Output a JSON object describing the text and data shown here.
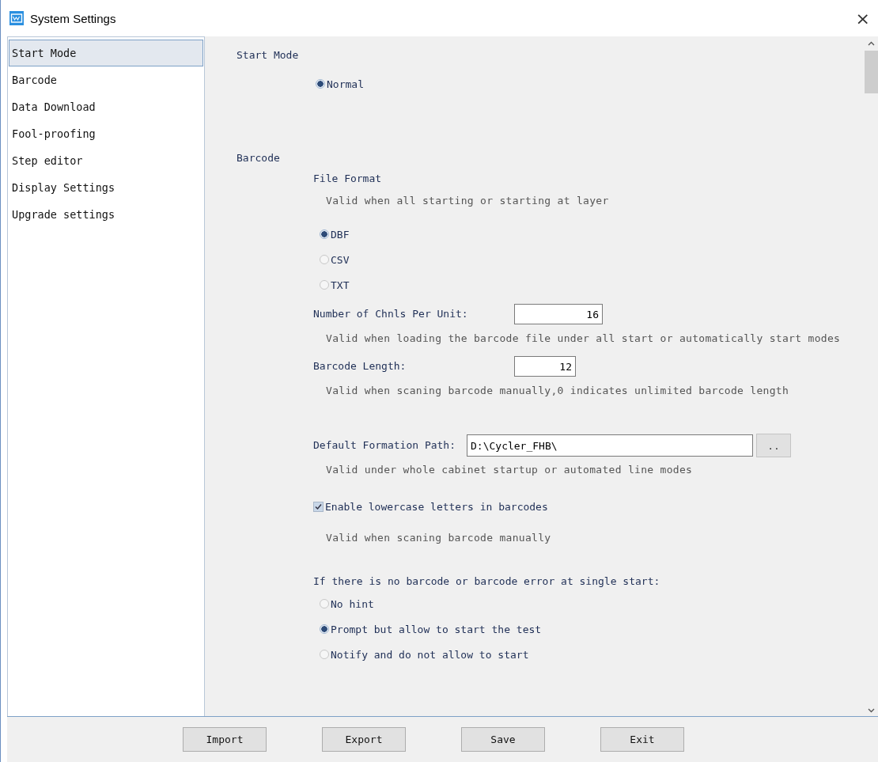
{
  "window": {
    "title": "System Settings",
    "close": "×"
  },
  "sidebar": {
    "items": [
      {
        "label": "Start Mode",
        "selected": true
      },
      {
        "label": "Barcode",
        "selected": false
      },
      {
        "label": "Data Download",
        "selected": false
      },
      {
        "label": "Fool-proofing",
        "selected": false
      },
      {
        "label": "Step editor",
        "selected": false
      },
      {
        "label": "Display Settings",
        "selected": false
      },
      {
        "label": "Upgrade settings",
        "selected": false
      }
    ]
  },
  "start_mode": {
    "heading": "Start Mode",
    "options": [
      {
        "label": "Normal",
        "selected": true
      }
    ]
  },
  "barcode": {
    "heading": "Barcode",
    "file_format": {
      "label": "File Format",
      "hint": "Valid when all starting or starting at layer",
      "options": [
        {
          "label": "DBF",
          "selected": true
        },
        {
          "label": "CSV",
          "selected": false
        },
        {
          "label": "TXT",
          "selected": false
        }
      ]
    },
    "channels": {
      "label": "Number of Chnls Per Unit:",
      "value": "16",
      "hint": "Valid when loading the barcode file under all start or automatically start modes"
    },
    "length": {
      "label": "Barcode Length:",
      "value": "12",
      "hint": "Valid when scaning barcode manually,0 indicates unlimited barcode length"
    },
    "path": {
      "label": "Default Formation Path:",
      "value": "D:\\Cycler_FHB\\",
      "browse": "..",
      "hint": "Valid under whole cabinet startup or  automated line modes"
    },
    "lowercase": {
      "label": "Enable lowercase letters in barcodes",
      "checked": true,
      "hint": "Valid when scaning barcode manually"
    },
    "no_barcode": {
      "label": "If there is no barcode or barcode error at single start:",
      "options": [
        {
          "label": "No hint",
          "selected": false
        },
        {
          "label": "Prompt but allow to start the test",
          "selected": true
        },
        {
          "label": "Notify and do not allow to start",
          "selected": false
        }
      ]
    }
  },
  "buttons": [
    "Import",
    "Export",
    "Save",
    "Exit"
  ]
}
